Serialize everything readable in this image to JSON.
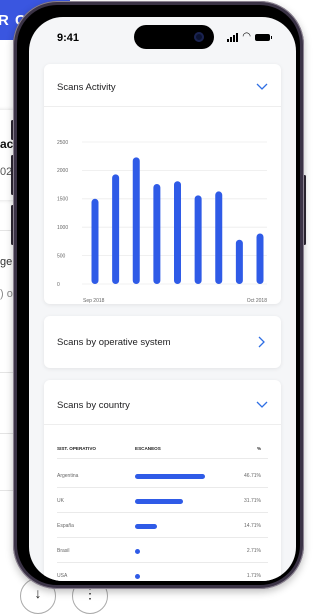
{
  "background": {
    "header_text": "R C",
    "card_text_1": "act",
    "card_text_2": "02",
    "text_3": "ge",
    "text_4": ") of",
    "fab_icon_1": "download-icon",
    "fab_icon_2": "more-icon"
  },
  "status_bar": {
    "time": "9:41",
    "icons": [
      "cellular-signal-icon",
      "wifi-icon",
      "battery-icon"
    ]
  },
  "scans_activity": {
    "title": "Scans Activity",
    "icon": "chevron-down-icon",
    "chart_data": {
      "type": "bar",
      "title": "",
      "xlabel": "",
      "ylabel": "",
      "ylim": [
        0,
        2500
      ],
      "yticks": [
        "2500",
        "2000",
        "1500",
        "1000",
        "500",
        "0"
      ],
      "x_start_label": "Sep 2018",
      "x_end_label": "Oct 2018",
      "grid": true,
      "color": "#2f5be7",
      "values": [
        1500,
        1930,
        2230,
        1760,
        1810,
        1560,
        1630,
        780,
        890
      ]
    }
  },
  "scans_os": {
    "title": "Scans by operative system",
    "icon": "chevron-right-icon"
  },
  "scans_country": {
    "title": "Scans by country",
    "icon": "chevron-down-icon",
    "columns": [
      "SIST. OPERATIVO",
      "ESCANEOS",
      "%"
    ],
    "rows": [
      {
        "country": "Argentina",
        "share": 0.4671,
        "pct": "46.71%"
      },
      {
        "country": "UK",
        "share": 0.3171,
        "pct": "31.71%"
      },
      {
        "country": "España",
        "share": 0.1471,
        "pct": "14.71%"
      },
      {
        "country": "Brasil",
        "share": 0.0271,
        "pct": "2.71%"
      },
      {
        "country": "USA",
        "share": 0.0171,
        "pct": "1.71%"
      }
    ],
    "bar_color": "#2f5be7"
  }
}
